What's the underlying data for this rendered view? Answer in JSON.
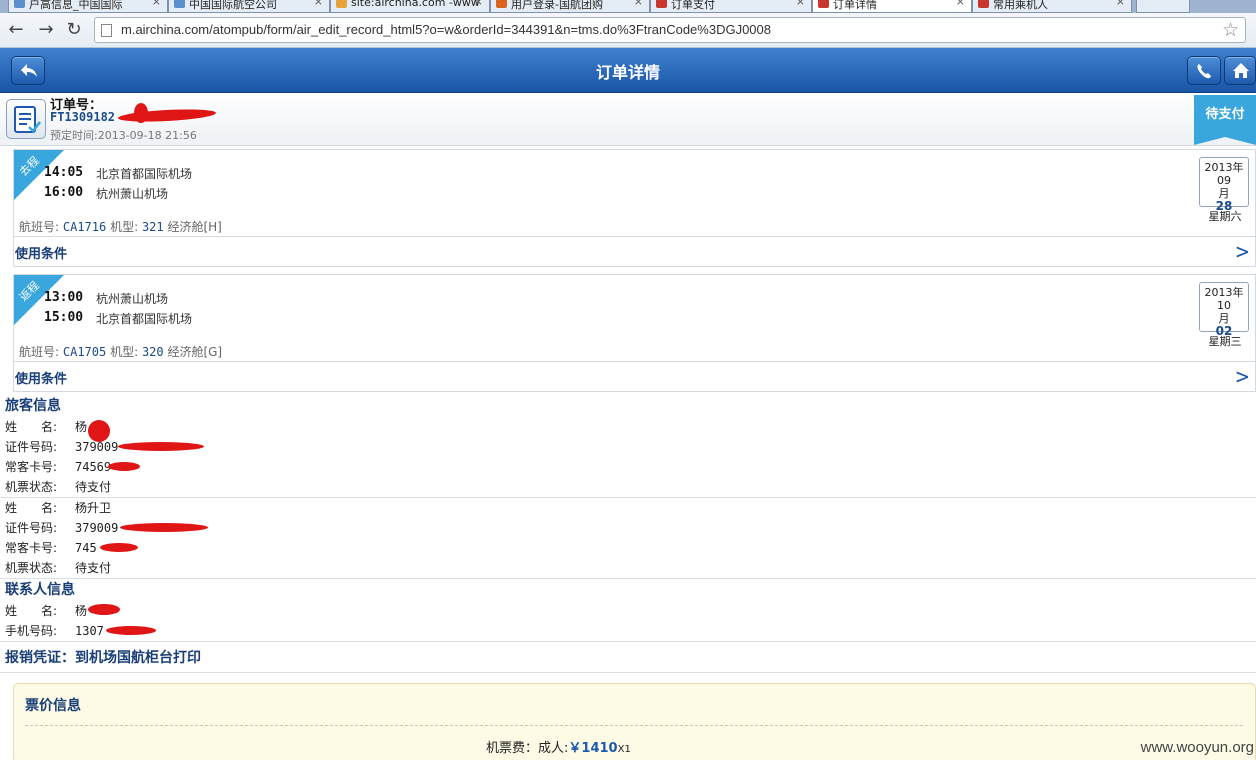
{
  "browser": {
    "tabs": [
      {
        "label": "户高信息_中国国际",
        "active": false,
        "color": "#5b8fd0"
      },
      {
        "label": "中国国际航空公司",
        "active": false,
        "color": "#5b8fd0"
      },
      {
        "label": "site:airchina.com -www",
        "active": false,
        "color": "#e8a33a"
      },
      {
        "label": "用户登录-国航团购",
        "active": false,
        "color": "#d9641f"
      },
      {
        "label": "订单支付",
        "active": false,
        "color": "#c8372d"
      },
      {
        "label": "订单详情",
        "active": true,
        "color": "#c8372d"
      },
      {
        "label": "常用乘机人",
        "active": false,
        "color": "#c8372d"
      }
    ],
    "url": "m.airchina.com/atompub/form/air_edit_record_html5?o=w&orderId=344391&n=tms.do%3FtranCode%3DGJ0008"
  },
  "header": {
    "title": "订单详情",
    "back_icon": "back-arrow-icon",
    "phone_icon": "phone-icon",
    "home_icon": "home-icon"
  },
  "order": {
    "label": "订单号：",
    "number": "FT1309182",
    "time": "预定时间:2013-09-18 21:56",
    "status": "待支付"
  },
  "segments": [
    {
      "tag": "去程",
      "dep_time": "14:05",
      "dep_airport": "北京首都国际机场",
      "arr_time": "16:00",
      "arr_airport": "杭州萧山机场",
      "flight_label": "航班号:",
      "flight_no": "CA1716",
      "aircraft_label": "机型:",
      "aircraft": "321",
      "cabin": "经济舱[H]",
      "cal_year_month": "2013年09",
      "cal_month_suffix": "月",
      "cal_day": "28",
      "weekday": "星期六",
      "conditions_label": "使用条件"
    },
    {
      "tag": "返程",
      "dep_time": "13:00",
      "dep_airport": "杭州萧山机场",
      "arr_time": "15:00",
      "arr_airport": "北京首都国际机场",
      "flight_label": "航班号:",
      "flight_no": "CA1705",
      "aircraft_label": "机型:",
      "aircraft": "320",
      "cabin": "经济舱[G]",
      "cal_year_month": "2013年10",
      "cal_month_suffix": "月",
      "cal_day": "02",
      "weekday": "星期三",
      "conditions_label": "使用条件"
    }
  ],
  "passengers_section": {
    "title": "旅客信息",
    "labels": {
      "name": "姓　　名:",
      "id": "证件号码:",
      "ffp": "常客卡号:",
      "status": "机票状态:"
    },
    "passengers": [
      {
        "name": "杨",
        "id": "379009",
        "ffp": "74569",
        "status": "待支付"
      },
      {
        "name": "杨升卫",
        "id": "379009",
        "ffp": "745",
        "status": "待支付"
      }
    ]
  },
  "contact_section": {
    "title": "联系人信息",
    "name_label": "姓　　名:",
    "name": "杨",
    "phone_label": "手机号码:",
    "phone": "1307"
  },
  "voucher": "报销凭证：到机场国航柜台打印",
  "price": {
    "title": "票价信息",
    "fare_label": "机票费：",
    "passenger_type": "成人:",
    "amount": "￥1410",
    "qty": "X1"
  },
  "watermark": "www.wooyun.org",
  "colors": {
    "header": "#1d5aad",
    "accent": "#3aa6de",
    "redaction": "#e01515",
    "price_bg": "#fdfbe6"
  }
}
